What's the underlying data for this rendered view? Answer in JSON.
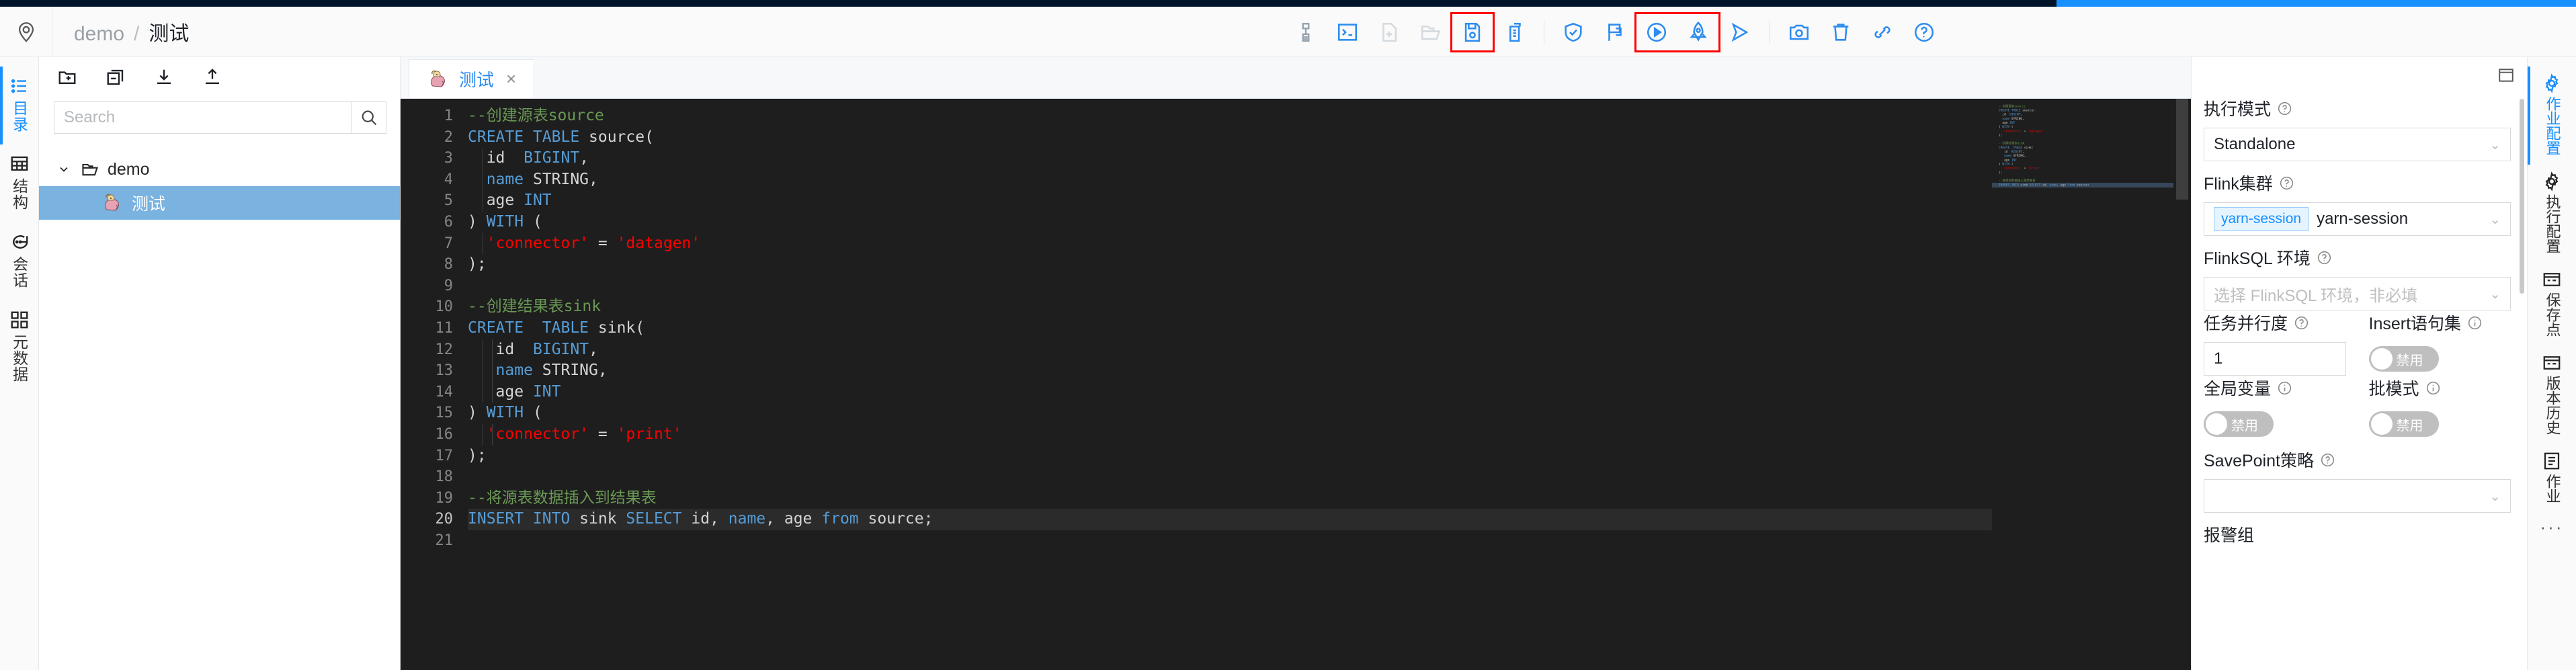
{
  "breadcrumb": {
    "root": "demo",
    "separator": "/",
    "current": "测试"
  },
  "toolbar": {
    "buttons": [
      {
        "name": "format-icon",
        "title": "格式化"
      },
      {
        "name": "terminal-icon",
        "title": "终端"
      },
      {
        "name": "new-file-icon",
        "title": "新建文件"
      },
      {
        "name": "open-folder-icon",
        "title": "打开目录"
      },
      {
        "name": "save-file-icon",
        "title": "保存",
        "highlighted": true
      },
      {
        "name": "copy-file-icon",
        "title": "另存为"
      },
      {
        "name": "check-shield-icon",
        "title": "校验"
      },
      {
        "name": "flag-icon",
        "title": "执行图"
      },
      {
        "name": "run-icon",
        "title": "运行",
        "highlighted": true
      },
      {
        "name": "rocket-icon",
        "title": "上线",
        "highlighted": true
      },
      {
        "name": "send-icon",
        "title": "提交"
      },
      {
        "name": "camera-icon",
        "title": "快照"
      },
      {
        "name": "trash-icon",
        "title": "删除"
      },
      {
        "name": "link-icon",
        "title": "连接"
      },
      {
        "name": "help-icon",
        "title": "帮助"
      }
    ]
  },
  "left_rail": {
    "items": [
      {
        "label": "目录",
        "icon": "list-icon",
        "active": true
      },
      {
        "label": "结构",
        "icon": "table-icon",
        "active": false
      },
      {
        "label": "会话",
        "icon": "chat-icon",
        "active": false
      },
      {
        "label": "元数据",
        "icon": "database-icon",
        "active": false
      }
    ]
  },
  "explorer": {
    "tools": [
      {
        "name": "new-folder-icon",
        "title": "新建目录"
      },
      {
        "name": "collapse-all-icon",
        "title": "折叠"
      },
      {
        "name": "import-icon",
        "title": "导入"
      },
      {
        "name": "export-icon",
        "title": "导出"
      }
    ],
    "search": {
      "placeholder": "Search",
      "value": "",
      "button_icon": "search-icon"
    },
    "tree": [
      {
        "label": "demo",
        "type": "folder",
        "expanded": true,
        "depth": 0,
        "selected": false
      },
      {
        "label": "测试",
        "type": "flink-job",
        "expanded": false,
        "depth": 1,
        "selected": true
      }
    ]
  },
  "editor": {
    "tab": {
      "label": "测试",
      "icon": "flink-squirrel-icon",
      "close": "×",
      "active": true
    },
    "total_lines": 21,
    "current_line": 20,
    "lines": [
      {
        "n": 1,
        "tokens": [
          {
            "t": "--创建源表source",
            "c": "cm"
          }
        ]
      },
      {
        "n": 2,
        "tokens": [
          {
            "t": "CREATE TABLE ",
            "c": "kw"
          },
          {
            "t": "source(",
            "c": "pl"
          }
        ]
      },
      {
        "n": 3,
        "tokens": [
          {
            "t": "  id  ",
            "c": "pl"
          },
          {
            "t": "BIGINT",
            "c": "kw"
          },
          {
            "t": ",",
            "c": "pl"
          }
        ]
      },
      {
        "n": 4,
        "tokens": [
          {
            "t": "  ",
            "c": "pl"
          },
          {
            "t": "name",
            "c": "kw"
          },
          {
            "t": " STRING,",
            "c": "pl"
          }
        ]
      },
      {
        "n": 5,
        "tokens": [
          {
            "t": "  age ",
            "c": "pl"
          },
          {
            "t": "INT",
            "c": "kw"
          }
        ]
      },
      {
        "n": 6,
        "tokens": [
          {
            "t": ") ",
            "c": "pl"
          },
          {
            "t": "WITH",
            "c": "kw"
          },
          {
            "t": " (",
            "c": "pl"
          }
        ]
      },
      {
        "n": 7,
        "tokens": [
          {
            "t": "  ",
            "c": "pl"
          },
          {
            "t": "'connector'",
            "c": "str"
          },
          {
            "t": " = ",
            "c": "pl"
          },
          {
            "t": "'datagen'",
            "c": "str"
          }
        ]
      },
      {
        "n": 8,
        "tokens": [
          {
            "t": ");",
            "c": "pl"
          }
        ]
      },
      {
        "n": 9,
        "tokens": []
      },
      {
        "n": 10,
        "tokens": [
          {
            "t": "--创建结果表sink",
            "c": "cm"
          }
        ]
      },
      {
        "n": 11,
        "tokens": [
          {
            "t": "CREATE  TABLE ",
            "c": "kw"
          },
          {
            "t": "sink(",
            "c": "pl"
          }
        ]
      },
      {
        "n": 12,
        "tokens": [
          {
            "t": "   id  ",
            "c": "pl"
          },
          {
            "t": "BIGINT",
            "c": "kw"
          },
          {
            "t": ",",
            "c": "pl"
          }
        ]
      },
      {
        "n": 13,
        "tokens": [
          {
            "t": "   ",
            "c": "pl"
          },
          {
            "t": "name",
            "c": "kw"
          },
          {
            "t": " STRING,",
            "c": "pl"
          }
        ]
      },
      {
        "n": 14,
        "tokens": [
          {
            "t": "   age ",
            "c": "pl"
          },
          {
            "t": "INT",
            "c": "kw"
          }
        ]
      },
      {
        "n": 15,
        "tokens": [
          {
            "t": ") ",
            "c": "pl"
          },
          {
            "t": "WITH",
            "c": "kw"
          },
          {
            "t": " (",
            "c": "pl"
          }
        ]
      },
      {
        "n": 16,
        "tokens": [
          {
            "t": "  ",
            "c": "pl"
          },
          {
            "t": "'connector'",
            "c": "str"
          },
          {
            "t": " = ",
            "c": "pl"
          },
          {
            "t": "'print'",
            "c": "str"
          }
        ]
      },
      {
        "n": 17,
        "tokens": [
          {
            "t": ");",
            "c": "pl"
          }
        ]
      },
      {
        "n": 18,
        "tokens": []
      },
      {
        "n": 19,
        "tokens": [
          {
            "t": "--将源表数据插入到结果表",
            "c": "cm"
          }
        ]
      },
      {
        "n": 20,
        "tokens": [
          {
            "t": "INSERT INTO ",
            "c": "kw"
          },
          {
            "t": "sink ",
            "c": "pl"
          },
          {
            "t": "SELECT",
            "c": "kw"
          },
          {
            "t": " id, ",
            "c": "pl"
          },
          {
            "t": "name",
            "c": "kw"
          },
          {
            "t": ", age ",
            "c": "pl"
          },
          {
            "t": "from",
            "c": "kw"
          },
          {
            "t": " source;",
            "c": "pl"
          }
        ]
      },
      {
        "n": 21,
        "tokens": []
      }
    ]
  },
  "config_panel": {
    "collapse_icon": "collapse-panel-icon",
    "fields": [
      {
        "key": "exec_mode",
        "label": "执行模式",
        "hint": "question",
        "control": "select",
        "value": "Standalone",
        "placeholder": ""
      },
      {
        "key": "flink_cluster",
        "label": "Flink集群",
        "hint": "question",
        "control": "select-tag",
        "tag": "yarn-session",
        "value": "yarn-session",
        "placeholder": ""
      },
      {
        "key": "flinksql_env",
        "label": "FlinkSQL 环境",
        "hint": "question",
        "control": "select",
        "value": "",
        "placeholder": "选择 FlinkSQL 环境，非必填"
      },
      {
        "key": "parallelism",
        "label": "任务并行度",
        "hint": "question",
        "control": "number",
        "value": "1"
      },
      {
        "key": "insert_set",
        "label": "Insert语句集",
        "hint": "info",
        "control": "switch",
        "value": "禁用",
        "on": false
      },
      {
        "key": "global_var",
        "label": "全局变量",
        "hint": "info",
        "control": "switch",
        "value": "禁用",
        "on": false
      },
      {
        "key": "batch_mode",
        "label": "批模式",
        "hint": "info",
        "control": "switch",
        "value": "禁用",
        "on": false
      },
      {
        "key": "savepoint",
        "label": "SavePoint策略",
        "hint": "question",
        "control": "select",
        "value": "",
        "placeholder": ""
      },
      {
        "key": "alert_group",
        "label": "报警组",
        "hint": "",
        "control": "none",
        "value": ""
      }
    ]
  },
  "right_rail": {
    "items": [
      {
        "label": "作业配置",
        "icon": "gear-icon",
        "active": true
      },
      {
        "label": "执行配置",
        "icon": "gear-icon",
        "active": false
      },
      {
        "label": "保存点",
        "icon": "savepoint-icon",
        "active": false
      },
      {
        "label": "版本历史",
        "icon": "history-icon",
        "active": false
      },
      {
        "label": "作业",
        "icon": "job-icon",
        "active": false
      }
    ],
    "more": "···"
  },
  "colors": {
    "accent": "#1890ff",
    "highlight_box": "#fe0000",
    "selected_row": "#7ab2e0",
    "editor_bg": "#1e1e1e"
  }
}
